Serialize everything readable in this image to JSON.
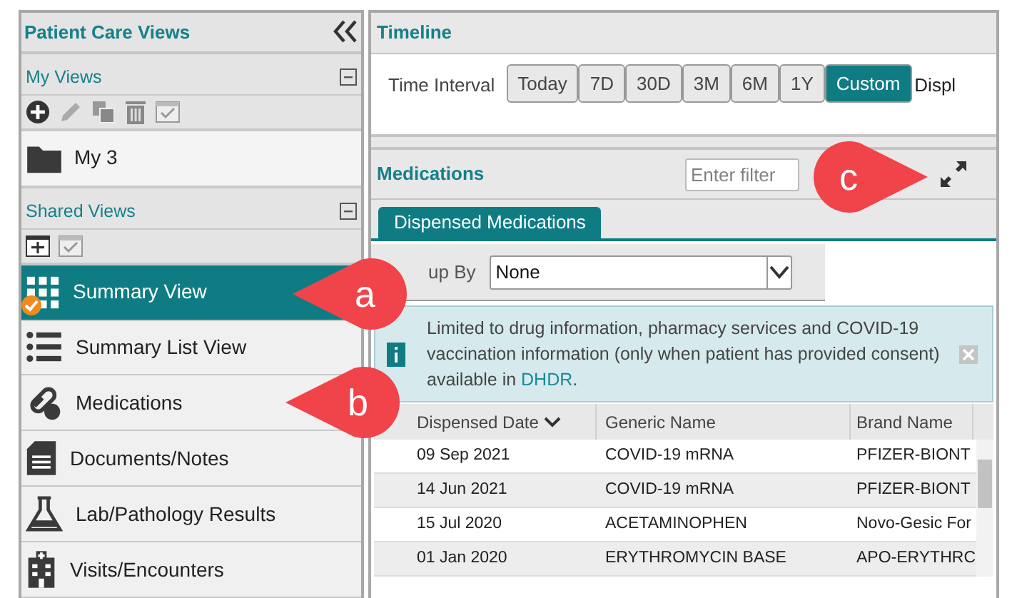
{
  "sidebar": {
    "title": "Patient Care Views",
    "my_views": {
      "title": "My Views",
      "expanded": true,
      "items": [
        {
          "label": "My 3",
          "kind": "folder"
        }
      ]
    },
    "shared_views": {
      "title": "Shared Views",
      "expanded": true,
      "items": [
        {
          "label": "Summary View",
          "kind": "grid",
          "selected": true,
          "checked": true
        },
        {
          "label": "Summary List View",
          "kind": "list",
          "selected": false,
          "checked": false
        },
        {
          "label": "Medications",
          "kind": "pills",
          "selected": false,
          "checked": false
        },
        {
          "label": "Documents/Notes",
          "kind": "document",
          "selected": false,
          "checked": false
        },
        {
          "label": "Lab/Pathology Results",
          "kind": "flask",
          "selected": false,
          "checked": false
        },
        {
          "label": "Visits/Encounters",
          "kind": "hospital",
          "selected": false,
          "checked": false
        }
      ]
    }
  },
  "timeline": {
    "title": "Timeline",
    "interval_label": "Time Interval",
    "intervals": [
      {
        "label": "Today",
        "selected": false
      },
      {
        "label": "7D",
        "selected": false
      },
      {
        "label": "30D",
        "selected": false
      },
      {
        "label": "3M",
        "selected": false
      },
      {
        "label": "6M",
        "selected": false
      },
      {
        "label": "1Y",
        "selected": false
      },
      {
        "label": "Custom",
        "selected": true
      }
    ],
    "trailing_text": "Displ"
  },
  "medications": {
    "title": "Medications",
    "filter": {
      "placeholder": "Enter filter"
    },
    "tabs": [
      {
        "label": "Dispensed Medications",
        "selected": true
      }
    ],
    "group_by": {
      "label": "up By",
      "value": "None"
    },
    "notice": {
      "text": "Limited to drug information, pharmacy services and COVID-19 vaccination information (only when patient has provided consent) available in ",
      "link": "DHDR",
      "end": "."
    },
    "table": {
      "columns": [
        "Dispensed Date",
        "Generic Name",
        "Brand Name"
      ],
      "rows": [
        [
          "09 Sep 2021",
          "COVID-19 mRNA",
          "PFIZER-BIONT"
        ],
        [
          "14 Jun 2021",
          "COVID-19 mRNA",
          "PFIZER-BIONT"
        ],
        [
          "15 Jul 2020",
          "ACETAMINOPHEN",
          "Novo-Gesic For"
        ],
        [
          "01 Jan 2020",
          "ERYTHROMYCIN BASE",
          "APO-ERYTHRC"
        ]
      ]
    }
  },
  "callouts": [
    {
      "label": "a"
    },
    {
      "label": "b"
    },
    {
      "label": "c"
    }
  ]
}
